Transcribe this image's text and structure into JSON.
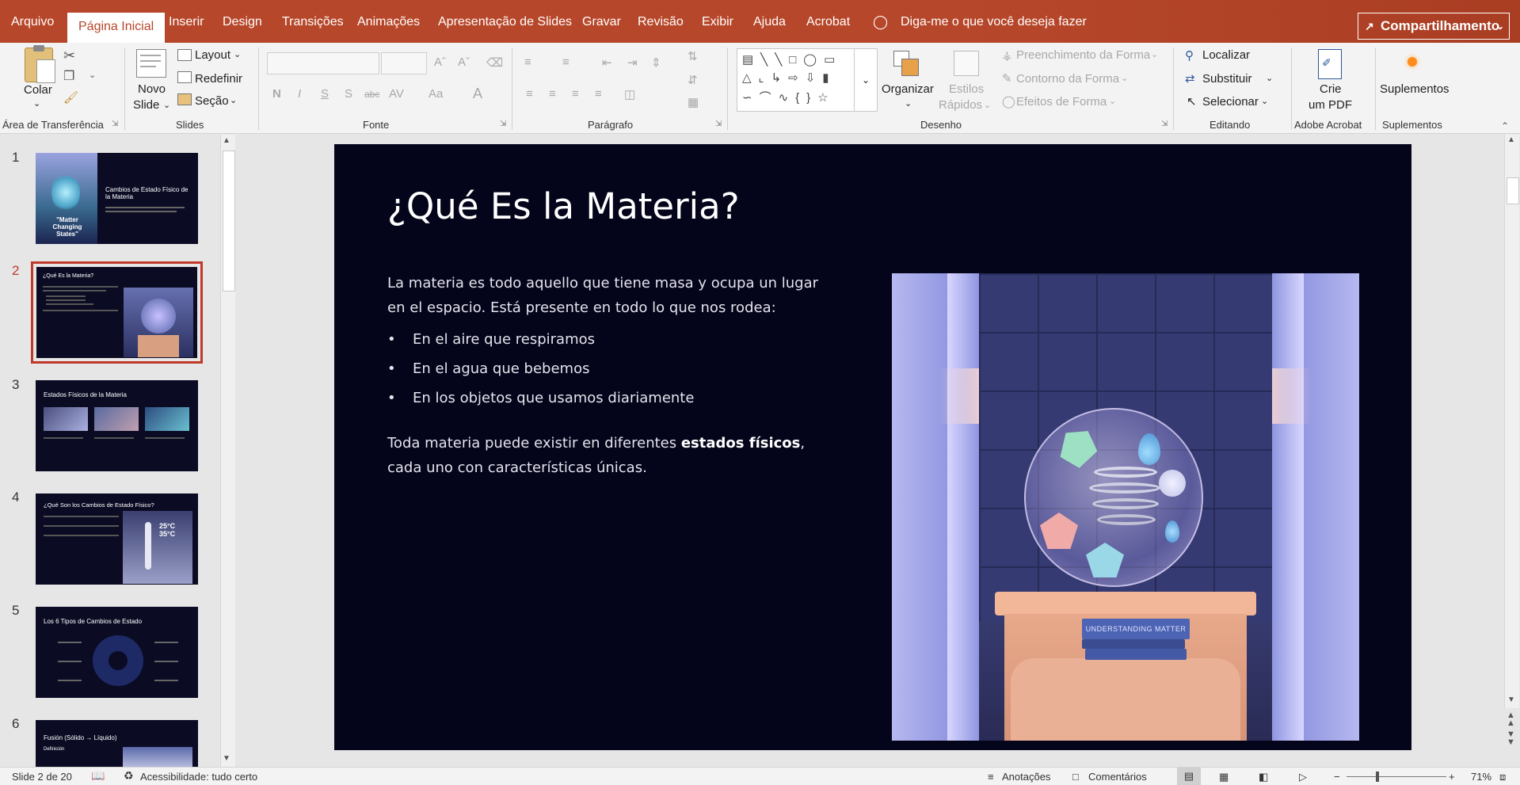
{
  "menu": {
    "file": "Arquivo",
    "home": "Página Inicial",
    "insert": "Inserir",
    "design": "Design",
    "transitions": "Transições",
    "animations": "Animações",
    "slideshow": "Apresentação de Slides",
    "record": "Gravar",
    "review": "Revisão",
    "view": "Exibir",
    "help": "Ajuda",
    "acrobat": "Acrobat",
    "tellme": "Diga-me o que você deseja fazer",
    "share": "Compartilhamento"
  },
  "ribbon": {
    "clipboard": {
      "paste": "Colar",
      "label": "Área de Transferência"
    },
    "slides": {
      "new_slide_1": "Novo",
      "new_slide_2": "Slide",
      "layout": "Layout",
      "reset": "Redefinir",
      "section": "Seção",
      "label": "Slides"
    },
    "font": {
      "label": "Fonte"
    },
    "paragraph": {
      "label": "Parágrafo"
    },
    "drawing": {
      "arrange": "Organizar",
      "quick_styles_1": "Estilos",
      "quick_styles_2": "Rápidos",
      "fill": "Preenchimento da Forma",
      "outline": "Contorno da Forma",
      "effects": "Efeitos de Forma",
      "label": "Desenho"
    },
    "editing": {
      "find": "Localizar",
      "replace": "Substituir",
      "select": "Selecionar",
      "label": "Editando"
    },
    "acrobat": {
      "create_pdf_1": "Crie",
      "create_pdf_2": "um PDF",
      "label": "Adobe Acrobat"
    },
    "addins": {
      "addins": "Suplementos",
      "label": "Suplementos"
    }
  },
  "thumbnails": [
    {
      "num": "1",
      "title": "Cambios de Estado Físico de la Materia",
      "caption": "\"Matter Changing States\""
    },
    {
      "num": "2",
      "title": "¿Qué Es la Materia?"
    },
    {
      "num": "3",
      "title": "Estados Físicos de la Materia"
    },
    {
      "num": "4",
      "title": "¿Qué Son los Cambios de Estado Físico?",
      "temp1": "25°C",
      "temp2": "35°C"
    },
    {
      "num": "5",
      "title": "Los 6 Tipos de Cambios de Estado"
    },
    {
      "num": "6",
      "title": "Fusión (Sólido → Líquido)",
      "sub": "Definición"
    }
  ],
  "slide": {
    "title": "¿Qué Es la Materia?",
    "intro": "La materia es todo aquello que tiene masa y ocupa un lugar en el espacio. Está presente en todo lo que nos rodea:",
    "bullets": [
      "En el aire que respiramos",
      "En el agua que bebemos",
      "En los objetos que usamos diariamente"
    ],
    "closing_pre": "Toda materia puede existir en diferentes ",
    "closing_bold": "estados físicos",
    "closing_post": ", cada uno con características únicas.",
    "book_text": "UNDERSTANDING MATTER"
  },
  "status": {
    "slide_count": "Slide 2 de 20",
    "accessibility": "Acessibilidade: tudo certo",
    "notes": "Anotações",
    "comments": "Comentários",
    "zoom": "71%"
  },
  "colors": {
    "accent": "#b7472a",
    "slide_bg": "#04041a",
    "selected_thumb": "#c0392b"
  }
}
